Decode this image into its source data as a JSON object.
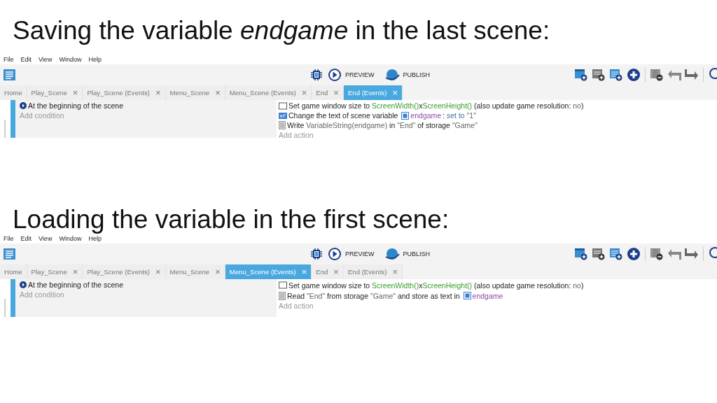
{
  "sections": [
    {
      "heading": "Saving the variable *endgame* in the last scene:",
      "editor": {
        "menu": [
          "File",
          "Edit",
          "View",
          "Window",
          "Help"
        ],
        "toolbar": {
          "preview": "PREVIEW",
          "publish": "PUBLISH"
        },
        "tabs": [
          {
            "label": "Home",
            "selected": false
          },
          {
            "label": "Play_Scene",
            "selected": false,
            "close": "×"
          },
          {
            "label": "Play_Scene (Events)",
            "selected": false,
            "close": "×"
          },
          {
            "label": "Menu_Scene",
            "selected": false,
            "close": "×"
          },
          {
            "label": "Menu_Scene (Events)",
            "selected": false,
            "close": "×"
          },
          {
            "label": "End",
            "selected": false,
            "close": "×"
          },
          {
            "label": "End (Events)",
            "selected": true,
            "close": "×"
          }
        ],
        "event": {
          "condition": "At the beginning of the scene",
          "add_condition": "Add condition",
          "add_action": "Add action",
          "actions": [
            {
              "kind": "window",
              "parts": [
                {
                  "kind": "text",
                  "text": "Set game window size to "
                },
                {
                  "kind": "expr",
                  "text": "ScreenWidth()"
                },
                {
                  "kind": "text",
                  "text": "x"
                },
                {
                  "kind": "expr",
                  "text": "ScreenHeight()"
                },
                {
                  "kind": "text",
                  "text": " (also update game resolution: "
                },
                {
                  "kind": "string",
                  "text": "no"
                },
                {
                  "kind": "text",
                  "text": ")"
                }
              ]
            },
            {
              "kind": "variable",
              "parts": [
                {
                  "kind": "text",
                  "text": "Change the text of scene variable "
                },
                {
                  "kind": "var",
                  "text": "endgame"
                },
                {
                  "kind": "text",
                  "text": ": "
                },
                {
                  "kind": "op",
                  "text": "set to "
                },
                {
                  "kind": "string",
                  "text": "\"1\""
                }
              ]
            },
            {
              "kind": "storage",
              "parts": [
                {
                  "kind": "text",
                  "text": "Write "
                },
                {
                  "kind": "string",
                  "text": "VariableString(endgame)"
                },
                {
                  "kind": "text",
                  "text": " in "
                },
                {
                  "kind": "string",
                  "text": "\"End\""
                },
                {
                  "kind": "text",
                  "text": " of storage "
                },
                {
                  "kind": "string",
                  "text": "\"Game\""
                }
              ]
            }
          ]
        }
      }
    },
    {
      "heading": "Loading the variable in the first scene:",
      "editor": {
        "menu": [
          "File",
          "Edit",
          "View",
          "Window",
          "Help"
        ],
        "toolbar": {
          "preview": "PREVIEW",
          "publish": "PUBLISH"
        },
        "tabs": [
          {
            "label": "Home",
            "selected": false
          },
          {
            "label": "Play_Scene",
            "selected": false,
            "close": "×"
          },
          {
            "label": "Play_Scene (Events)",
            "selected": false,
            "close": "×"
          },
          {
            "label": "Menu_Scene",
            "selected": false,
            "close": "×"
          },
          {
            "label": "Menu_Scene (Events)",
            "selected": true,
            "close": "×"
          },
          {
            "label": "End",
            "selected": false,
            "close": "×"
          },
          {
            "label": "End (Events)",
            "selected": false,
            "close": "×"
          }
        ],
        "event": {
          "condition": "At the beginning of the scene",
          "add_condition": "Add condition",
          "add_action": "Add action",
          "actions": [
            {
              "kind": "window",
              "parts": [
                {
                  "kind": "text",
                  "text": "Set game window size to "
                },
                {
                  "kind": "expr",
                  "text": "ScreenWidth()"
                },
                {
                  "kind": "text",
                  "text": "x"
                },
                {
                  "kind": "expr",
                  "text": "ScreenHeight()"
                },
                {
                  "kind": "text",
                  "text": " (also update game resolution: "
                },
                {
                  "kind": "string",
                  "text": "no"
                },
                {
                  "kind": "text",
                  "text": ")"
                }
              ]
            },
            {
              "kind": "storage",
              "parts": [
                {
                  "kind": "text",
                  "text": "Read "
                },
                {
                  "kind": "string",
                  "text": "\"End\""
                },
                {
                  "kind": "text",
                  "text": " from storage "
                },
                {
                  "kind": "string",
                  "text": "\"Game\""
                },
                {
                  "kind": "text",
                  "text": " and store as text in "
                },
                {
                  "kind": "var",
                  "text": "endgame"
                }
              ]
            }
          ]
        }
      }
    }
  ]
}
